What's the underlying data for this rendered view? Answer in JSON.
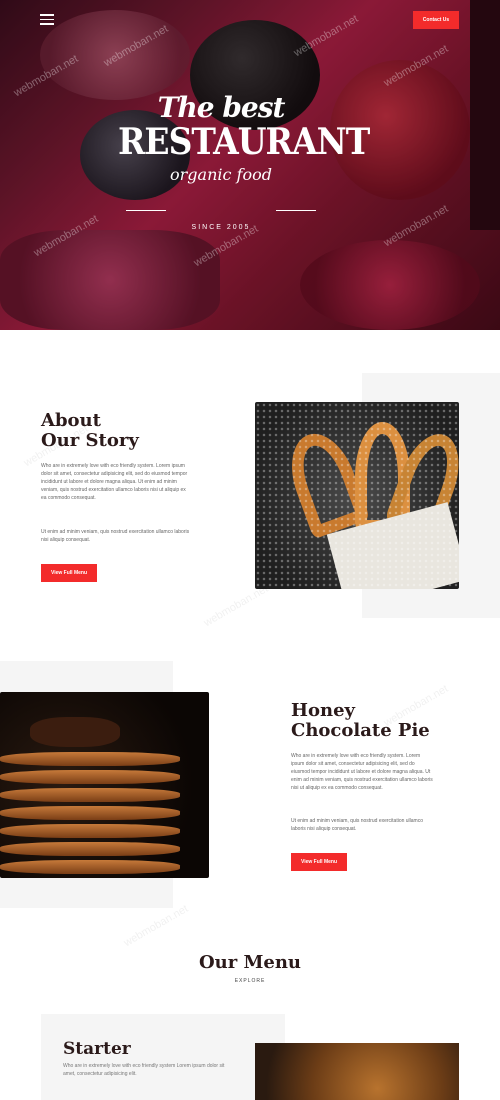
{
  "header": {
    "menu_icon": "hamburger-icon",
    "contact_label": "Contact Us"
  },
  "hero": {
    "logo_line1": "The best",
    "logo_line2": "RESTAURANT",
    "logo_line3": "organic food",
    "logo_since": "SINCE 2005"
  },
  "about": {
    "title_line1": "About",
    "title_line2": "Our Story",
    "para1": "Who are in extremely love with eco friendly system. Lorem ipsum dolor sit amet, consectetur adipisicing elit, sed do eiusmod tempor incididunt ut labore et dolore magna aliqua. Ut enim ad minim veniam, quis nostrud exercitation ullamco laboris nisi ut aliquip ex ea commodo consequat.",
    "para2": "Ut enim ad minim veniam, quis nostrud exercitation ullamco laboris nisi aliquip consequat.",
    "button_label": "View Full Menu"
  },
  "honey": {
    "title_line1": "Honey",
    "title_line2": "Chocolate Pie",
    "para1": "Who are in extremely love with eco friendly system. Lorem ipsum dolor sit amet, consectetur adipisicing elit, sed do eiusmod tempor incididunt ut labore et dolore magna aliqua. Ut enim ad minim veniam, quis nostrud exercitation ullamco laboris nisi ut aliquip ex ea commodo consequat.",
    "para2": "Ut enim ad minim veniam, quis nostrud exercitation ullamco laboris nisi aliquip consequat.",
    "button_label": "View Full Menu"
  },
  "our_menu": {
    "title": "Our Menu",
    "subtitle": "EXPLORE"
  },
  "starter": {
    "title": "Starter",
    "text": "Who are in extremely love with eco friendly system Lorem ipsum dolor sit amet, consectetur adipisicing elit."
  },
  "watermark": "webmoban.net",
  "colors": {
    "accent": "#f32b2b",
    "heading": "#2b1a1a",
    "panel": "#f5f5f5"
  }
}
